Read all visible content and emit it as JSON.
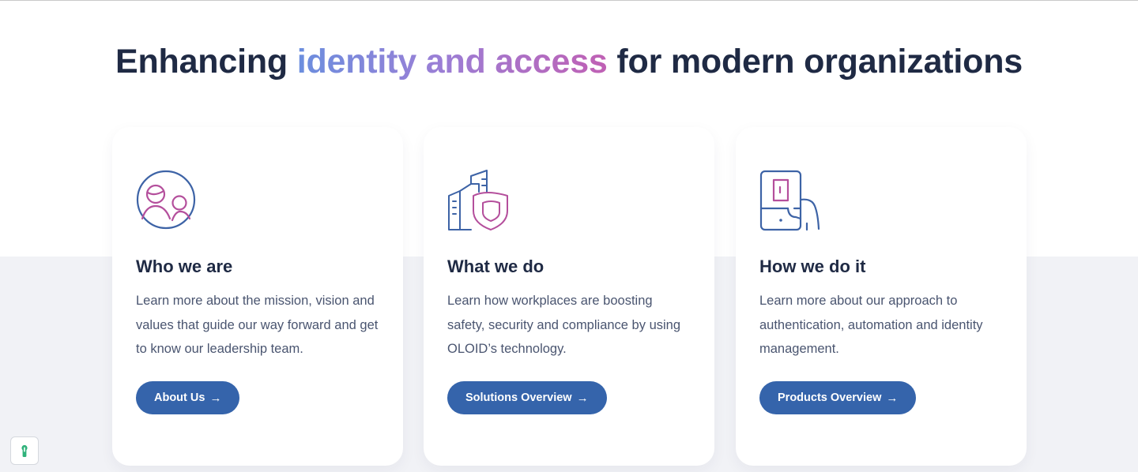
{
  "headline": {
    "part1": "Enhancing ",
    "highlight": "identity and access",
    "part2": " for modern organizations"
  },
  "cards": [
    {
      "icon": "people-circle-icon",
      "title": "Who we are",
      "text": "Learn more about the mission, vision and values that guide our way forward and get to know our leadership team.",
      "button": "About Us",
      "arrow": "→"
    },
    {
      "icon": "buildings-shield-icon",
      "title": "What we do",
      "text": "Learn how workplaces are boosting safety, security and compliance by using OLOID’s technology.",
      "button": "Solutions Overview",
      "arrow": "→"
    },
    {
      "icon": "phone-hand-door-icon",
      "title": "How we do it",
      "text": "Learn more about our approach to authentication, automation and identity management.",
      "button": "Products Overview",
      "arrow": "→"
    }
  ],
  "widget": {
    "icon": "keyhole-icon"
  },
  "colors": {
    "heading": "#1f2a44",
    "button": "#3564ab",
    "icon_blue": "#3d63a6",
    "icon_pink": "#b44f9c",
    "band": "#f1f2f6"
  }
}
